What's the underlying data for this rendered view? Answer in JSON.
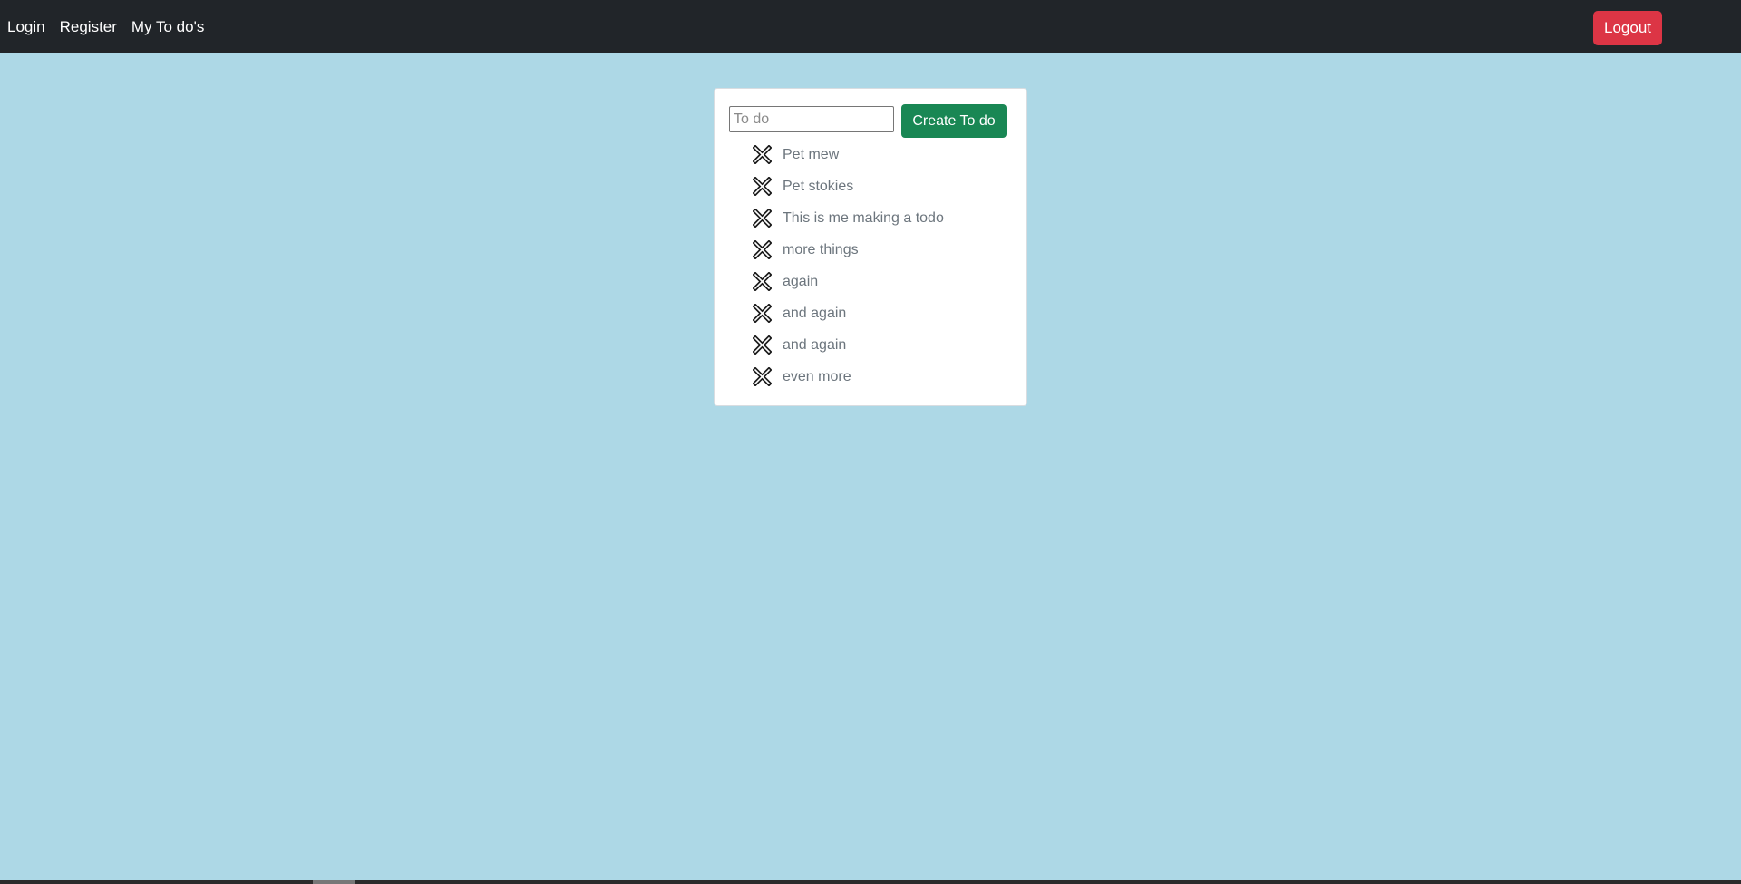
{
  "navbar": {
    "links": [
      "Login",
      "Register",
      "My To do's"
    ],
    "logout_label": "Logout",
    "background": "#212529",
    "logout_color": "#dc3545"
  },
  "page": {
    "background": "#add8e6"
  },
  "todo_form": {
    "input_placeholder": "To do",
    "input_value": "",
    "create_label": "Create To do",
    "create_color": "#198754"
  },
  "todos": [
    {
      "text": "Pet mew",
      "icon": "x-delete-icon"
    },
    {
      "text": "Pet stokies",
      "icon": "x-delete-icon"
    },
    {
      "text": "This is me making a todo",
      "icon": "x-delete-icon"
    },
    {
      "text": "more things",
      "icon": "x-delete-icon"
    },
    {
      "text": "again",
      "icon": "x-delete-icon"
    },
    {
      "text": "and again",
      "icon": "x-delete-icon"
    },
    {
      "text": "and again",
      "icon": "x-delete-icon"
    },
    {
      "text": "even more",
      "icon": "x-delete-icon"
    }
  ]
}
